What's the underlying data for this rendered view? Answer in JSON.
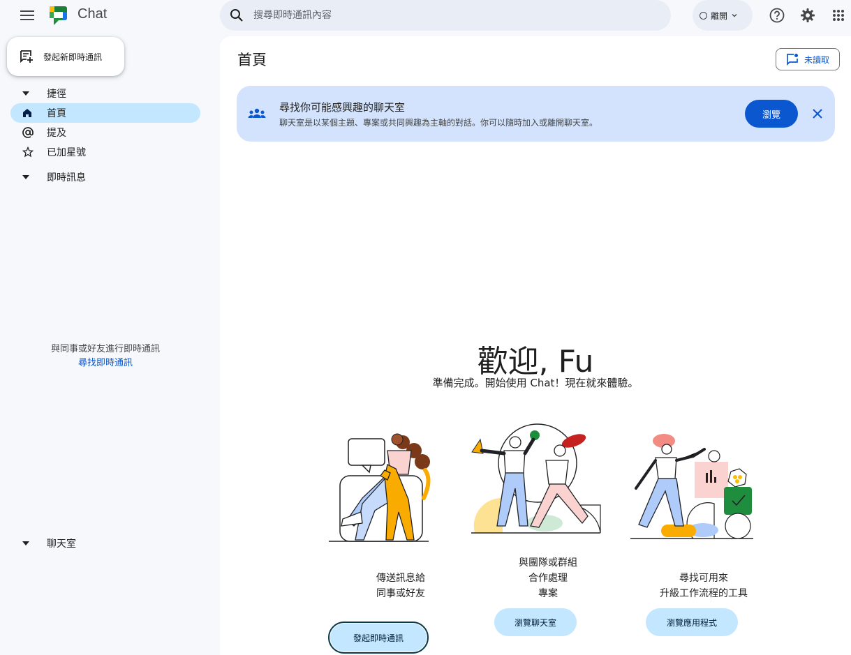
{
  "app": {
    "title": "Chat"
  },
  "search": {
    "placeholder": "搜尋即時通訊內容"
  },
  "status": {
    "label": "離開"
  },
  "sidebar": {
    "new_chat_label": "發起新即時通訊",
    "items": [
      {
        "label": "捷徑",
        "icon": "caret-down-icon"
      },
      {
        "label": "首頁",
        "icon": "home-icon",
        "active": true
      },
      {
        "label": "提及",
        "icon": "at-icon"
      },
      {
        "label": "已加星號",
        "icon": "star-icon"
      },
      {
        "label": "即時訊息",
        "icon": "caret-down-icon"
      },
      {
        "label": "聊天室",
        "icon": "caret-down-icon"
      }
    ],
    "empty_text": "與同事或好友進行即時通訊",
    "empty_link": "尋找即時通訊"
  },
  "main": {
    "title": "首頁",
    "unread_label": "未讀取",
    "banner": {
      "title": "尋找你可能感興趣的聊天室",
      "description": "聊天室是以某個主題、專案或共同興趣為主軸的對話。你可以隨時加入或離開聊天室。",
      "browse_label": "瀏覽"
    },
    "welcome_title": "歡迎, Fu",
    "welcome_subtitle": "準備完成。開始使用 Chat！現在就來體驗。",
    "cards": [
      {
        "label": "傳送訊息給\n同事或好友",
        "button": "發起即時通訊"
      },
      {
        "label": "與團隊或群組\n合作處理\n專案",
        "button": "瀏覽聊天室"
      },
      {
        "label": "尋找可用來\n升級工作流程的工具",
        "button": "瀏覽應用程式"
      }
    ]
  },
  "colors": {
    "accent": "#0b57d0",
    "active_nav": "#c2e7ff",
    "banner_bg": "#d3e3fd",
    "surface": "#f6f8fc"
  }
}
